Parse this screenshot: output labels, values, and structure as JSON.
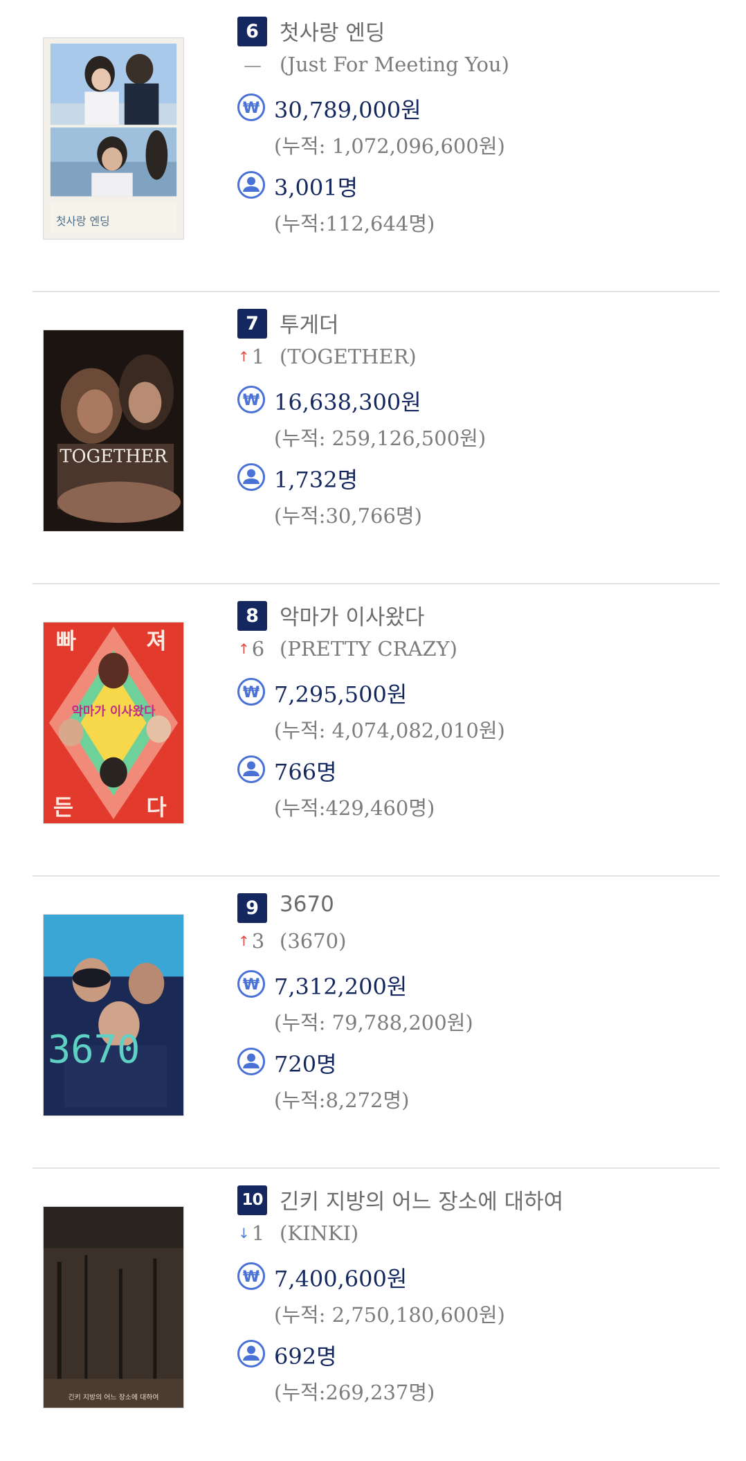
{
  "colors": {
    "rank_badge": "#14275f",
    "value_text": "#14275f",
    "secondary_text": "#7c7c7c",
    "rise": "#e34a4a",
    "fall": "#4f7fd8",
    "icon": "#4a72d6"
  },
  "icons": {
    "sales": "won-circle-icon",
    "audience": "user-circle-icon"
  },
  "movies": [
    {
      "rank": "6",
      "title": "첫사랑 엔딩",
      "change_dir": "none",
      "change_arrow": "—",
      "change_value": "",
      "original_title": "(Just For Meeting You)",
      "sales": "30,789,000원",
      "sales_cum": "(누적: 1,072,096,600원)",
      "audience": "3,001명",
      "audience_cum": "(누적:112,644명)",
      "poster_text": "첫사랑 엔딩"
    },
    {
      "rank": "7",
      "title": "투게더",
      "change_dir": "up",
      "change_arrow": "↑",
      "change_value": "1",
      "original_title": "(TOGETHER)",
      "sales": "16,638,300원",
      "sales_cum": "(누적: 259,126,500원)",
      "audience": "1,732명",
      "audience_cum": "(누적:30,766명)",
      "poster_text": "TOGETHER"
    },
    {
      "rank": "8",
      "title": "악마가 이사왔다",
      "change_dir": "up",
      "change_arrow": "↑",
      "change_value": "6",
      "original_title": "(PRETTY CRAZY)",
      "sales": "7,295,500원",
      "sales_cum": "(누적: 4,074,082,010원)",
      "audience": "766명",
      "audience_cum": "(누적:429,460명)",
      "poster_text": "악마가 이사왔다"
    },
    {
      "rank": "9",
      "title": "3670",
      "change_dir": "up",
      "change_arrow": "↑",
      "change_value": "3",
      "original_title": "(3670)",
      "sales": "7,312,200원",
      "sales_cum": "(누적: 79,788,200원)",
      "audience": "720명",
      "audience_cum": "(누적:8,272명)",
      "poster_text": "3670"
    },
    {
      "rank": "10",
      "title": "긴키 지방의 어느 장소에 대하여",
      "change_dir": "down",
      "change_arrow": "↓",
      "change_value": "1",
      "original_title": "(KINKI)",
      "sales": "7,400,600원",
      "sales_cum": "(누적: 2,750,180,600원)",
      "audience": "692명",
      "audience_cum": "(누적:269,237명)",
      "poster_text": "긴키 지방의 어느 장소에 대하여"
    }
  ]
}
